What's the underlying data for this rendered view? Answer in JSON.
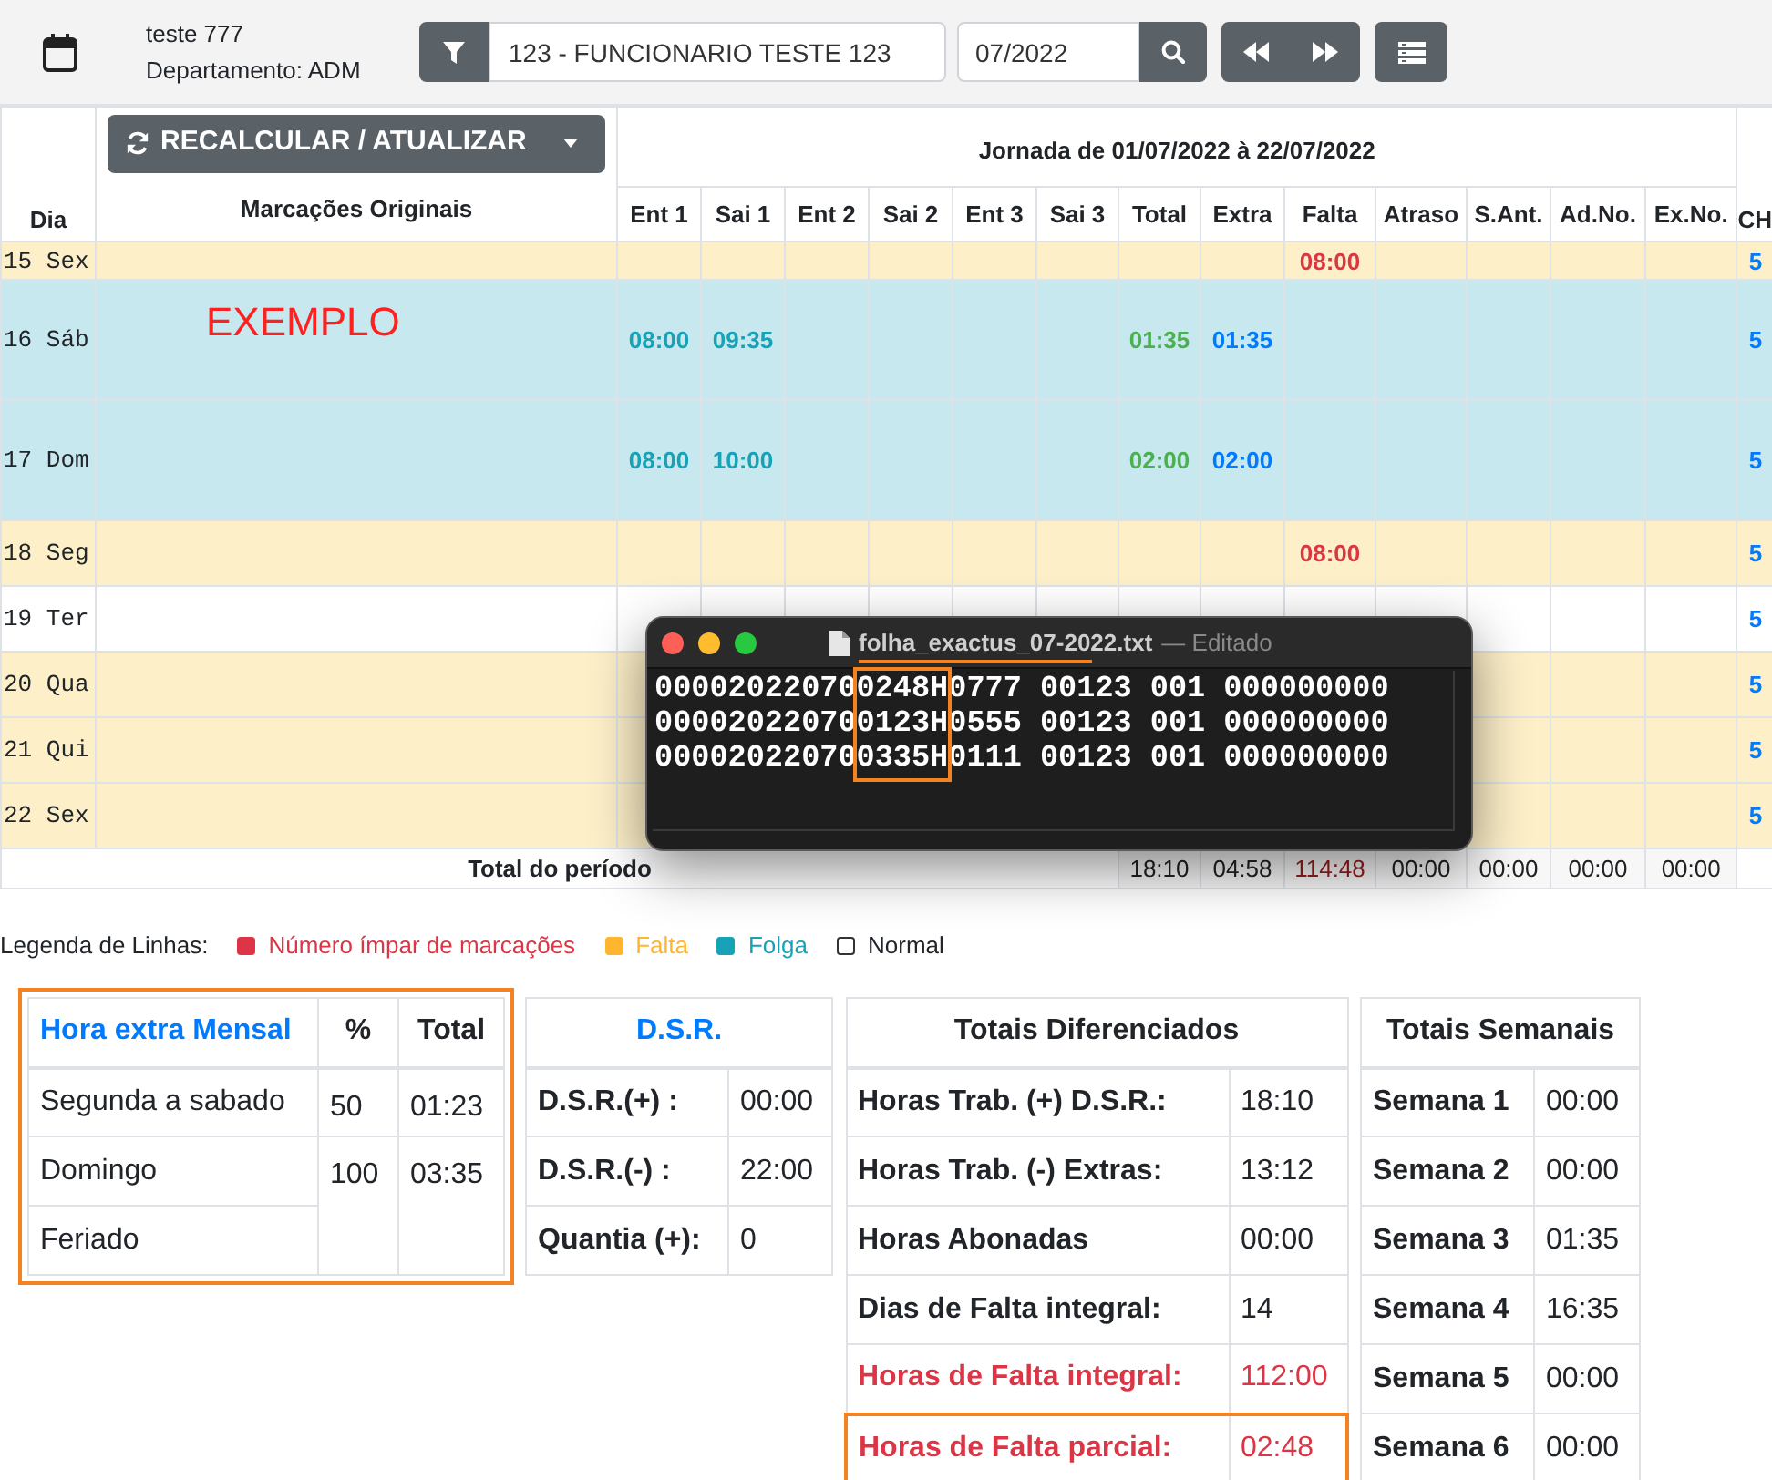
{
  "header": {
    "user": "teste 777",
    "department": "Departamento: ADM",
    "employee_filter": "123 - FUNCIONARIO TESTE 123",
    "period": "07/2022"
  },
  "table": {
    "recalc_button": "RECALCULAR / ATUALIZAR",
    "day_column": "Dia",
    "marks_column": "Marcações Originais",
    "period_title": "Jornada de 01/07/2022 à 22/07/2022",
    "ch_column": "CH",
    "columns": [
      "Ent 1",
      "Sai 1",
      "Ent 2",
      "Sai 2",
      "Ent 3",
      "Sai 3",
      "Total",
      "Extra",
      "Falta",
      "Atraso",
      "S.Ant.",
      "Ad.No.",
      "Ex.No."
    ],
    "rows": [
      {
        "day": "15 Sex",
        "kind": "falta",
        "falta": "08:00",
        "ch": "5"
      },
      {
        "day": "16 Sáb",
        "kind": "folga",
        "marks": "EXEMPLO",
        "ent_1": "08:00",
        "sai_1": "09:35",
        "total": "01:35",
        "extra": "01:35",
        "ch": "5"
      },
      {
        "day": "17 Dom",
        "kind": "folga",
        "ent_1": "08:00",
        "sai_1": "10:00",
        "total": "02:00",
        "extra": "02:00",
        "ch": "5"
      },
      {
        "day": "18 Seg",
        "kind": "falta",
        "falta": "08:00",
        "ch": "5"
      },
      {
        "day": "19 Ter",
        "kind": "normal",
        "ch": "5"
      },
      {
        "day": "20 Qua",
        "kind": "falta",
        "ch": "5"
      },
      {
        "day": "21 Qui",
        "kind": "falta",
        "ch": "5"
      },
      {
        "day": "22 Sex",
        "kind": "falta",
        "ch": "5"
      }
    ],
    "total": {
      "label": "Total do período",
      "values": [
        "18:10",
        "04:58",
        "114:48",
        "00:00",
        "00:00",
        "00:00",
        "00:00"
      ]
    }
  },
  "editor": {
    "filename": "folha_exactus_07-2022.txt",
    "status": "— Editado",
    "filename_underlined": true,
    "highlighted": true,
    "lines": [
      "000020220700248H0777 00123 001 000000000",
      "000020220700123H0555 00123 001 000000000",
      "000020220700335H0111 00123 001 000000000"
    ]
  },
  "legend": {
    "label": "Legenda de Linhas:",
    "items": [
      {
        "label": "Número ímpar de marcações",
        "color": "#dc3545",
        "text_colored": true
      },
      {
        "label": "Falta",
        "color": "#ffb52e",
        "text_colored": true
      },
      {
        "label": "Folga",
        "color": "#17a2b8",
        "text_colored": true
      },
      {
        "label": "Normal",
        "color": "#ffffff",
        "text_colored": false
      }
    ]
  },
  "overtime": {
    "title": "Hora extra Mensal",
    "columns": [
      "%",
      "Total"
    ],
    "highlighted": true,
    "rows": [
      {
        "label": "Segunda a sabado",
        "percent": "50",
        "total": "01:23"
      },
      {
        "label": "Domingo",
        "percent": "100",
        "total": "03:35"
      },
      {
        "label": "Feriado"
      }
    ]
  },
  "dsr": {
    "title": "D.S.R.",
    "rows": [
      {
        "label": "D.S.R.(+) :",
        "value": "00:00"
      },
      {
        "label": "D.S.R.(-) :",
        "value": "22:00"
      },
      {
        "label": "Quantia (+):",
        "value": "0"
      }
    ]
  },
  "totals": {
    "title": "Totais Diferenciados",
    "rows": [
      {
        "label": "Horas Trab. (+) D.S.R.:",
        "value": "18:10",
        "alert": false,
        "highlighted": false
      },
      {
        "label": "Horas Trab. (-) Extras:",
        "value": "13:12",
        "alert": false,
        "highlighted": false
      },
      {
        "label": "Horas Abonadas",
        "value": "00:00",
        "alert": false,
        "highlighted": false
      },
      {
        "label": "Dias de Falta integral:",
        "value": "14",
        "alert": false,
        "highlighted": false
      },
      {
        "label": "Horas de Falta integral:",
        "value": "112:00",
        "alert": true,
        "highlighted": false
      },
      {
        "label": "Horas de Falta parcial:",
        "value": "02:48",
        "alert": true,
        "highlighted": true
      }
    ]
  },
  "weekly": {
    "title": "Totais Semanais",
    "rows": [
      {
        "label": "Semana 1",
        "value": "00:00"
      },
      {
        "label": "Semana 2",
        "value": "00:00"
      },
      {
        "label": "Semana 3",
        "value": "01:35"
      },
      {
        "label": "Semana 4",
        "value": "16:35"
      },
      {
        "label": "Semana 5",
        "value": "00:00"
      },
      {
        "label": "Semana 6",
        "value": "00:00"
      }
    ]
  }
}
